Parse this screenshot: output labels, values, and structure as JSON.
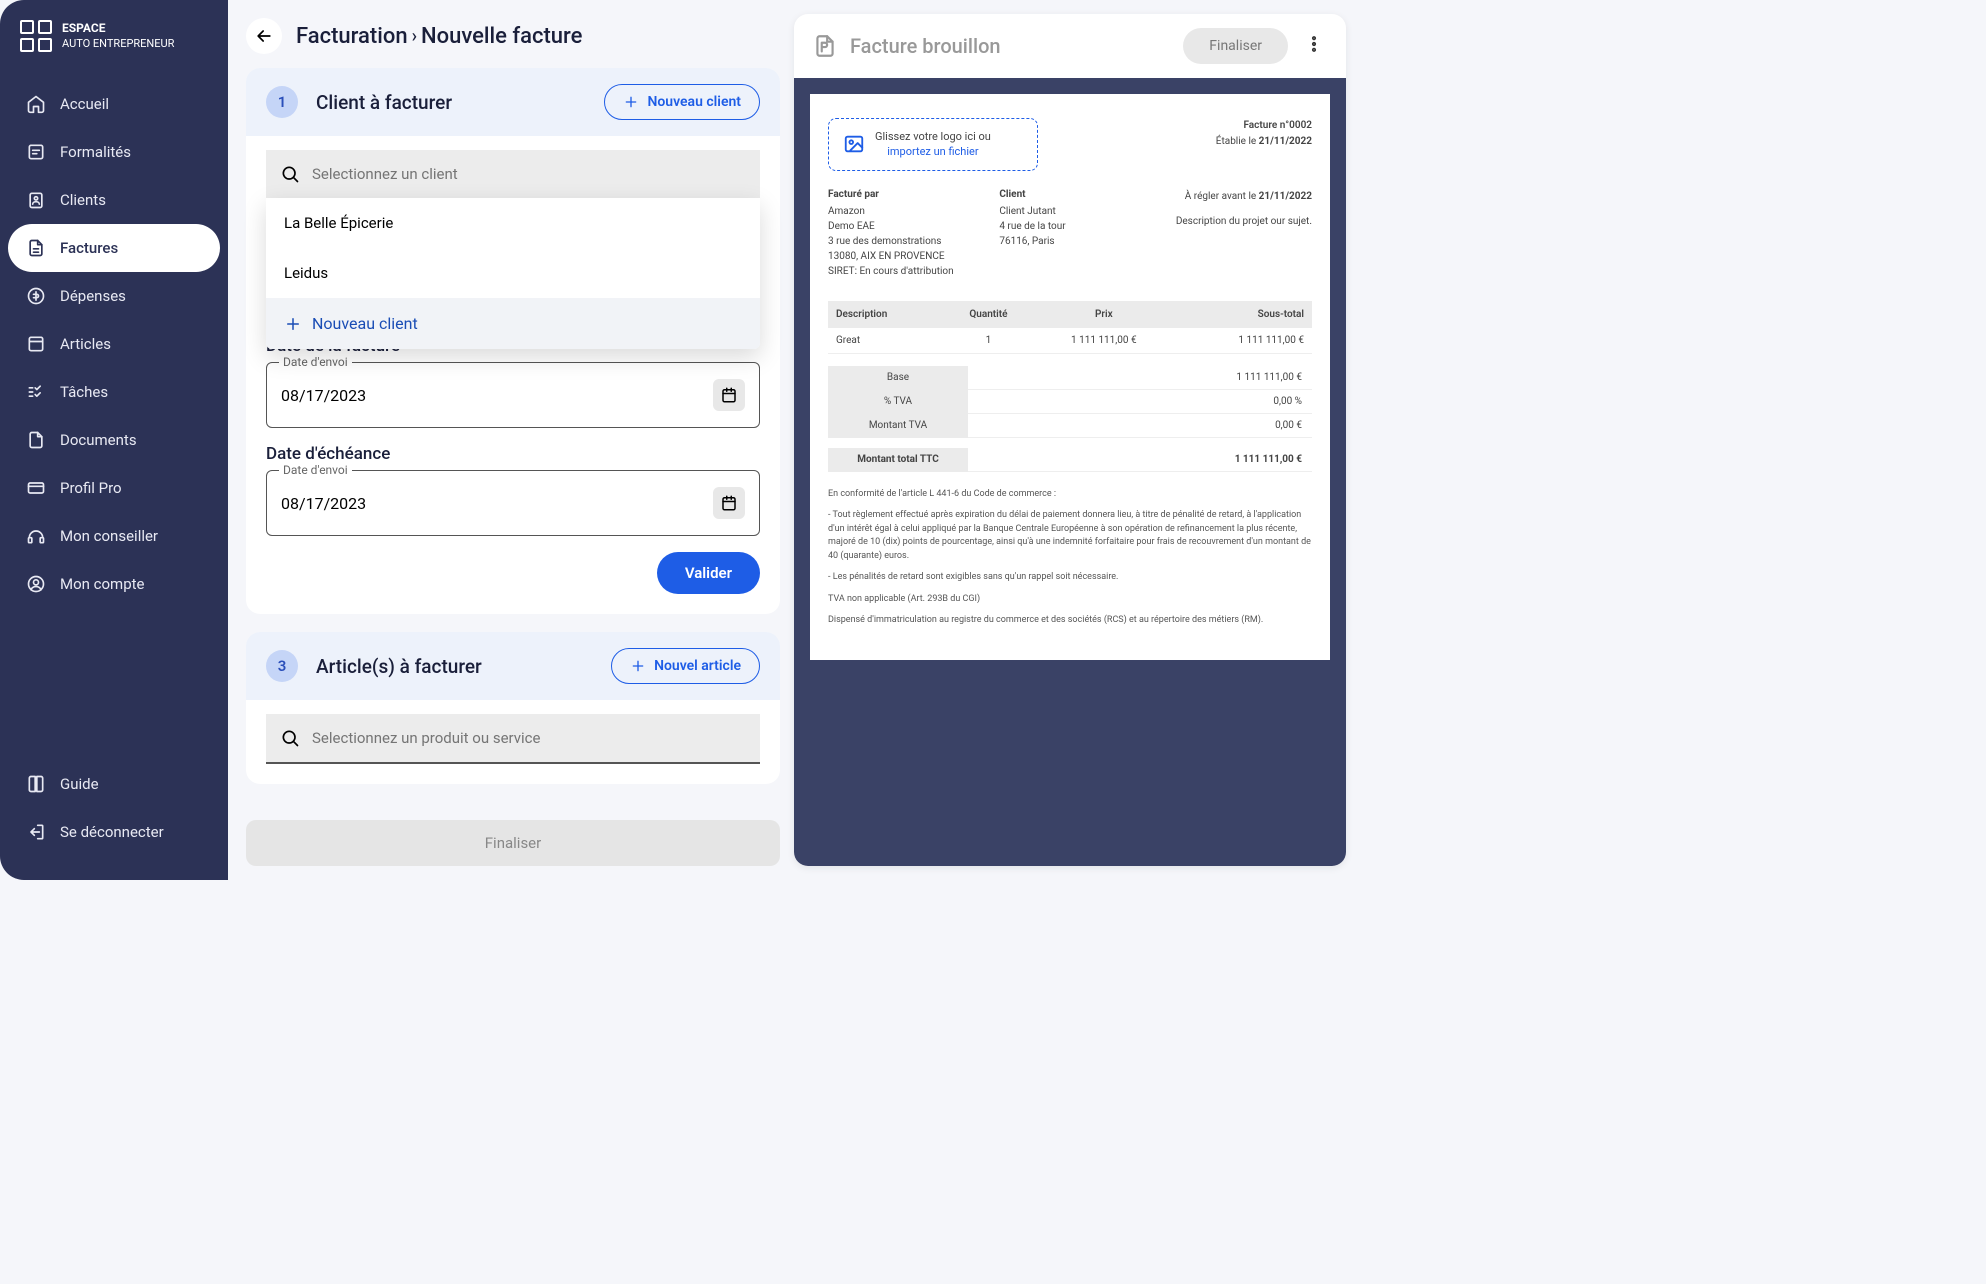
{
  "brand": {
    "line1": "ESPACE",
    "line2": "AUTO ENTREPRENEUR"
  },
  "nav": {
    "accueil": "Accueil",
    "formalites": "Formalités",
    "clients": "Clients",
    "factures": "Factures",
    "depenses": "Dépenses",
    "articles": "Articles",
    "taches": "Tâches",
    "documents": "Documents",
    "profil": "Profil Pro",
    "conseiller": "Mon conseiller",
    "compte": "Mon compte",
    "guide": "Guide",
    "deconnecter": "Se déconnecter"
  },
  "breadcrumb": {
    "a": "Facturation",
    "b": "Nouvelle facture"
  },
  "step1": {
    "num": "1",
    "title": "Client à facturer",
    "new_btn": "Nouveau client",
    "search_placeholder": "Selectionnez un client",
    "options": [
      "La Belle Épicerie",
      "Leidus"
    ],
    "dd_new": "Nouveau client",
    "date_facture_label": "Date de la facture",
    "date_echeance_label": "Date d'échéance",
    "date_floating": "Date d'envoi",
    "date_value": "08/17/2023",
    "valider": "Valider"
  },
  "step3": {
    "num": "3",
    "title": "Article(s) à facturer",
    "new_btn": "Nouvel article",
    "search_placeholder": "Selectionnez un produit ou service"
  },
  "finalize": "Finaliser",
  "preview": {
    "title": "Facture brouillon",
    "finaliser": "Finaliser",
    "logo_text1": "Glissez votre logo ici ou",
    "logo_text2": "importez un fichier",
    "meta_num": "Facture n°0002",
    "meta_etablie_lbl": "Établie le ",
    "meta_etablie": "21/11/2022",
    "facture_par": "Facturé par",
    "client_lbl": "Client",
    "regler_lbl": "À régler avant le ",
    "regler_date": "21/11/2022",
    "desc_projet": "Description du projet our sujet.",
    "from": {
      "l1": "Amazon",
      "l2": "Demo EAE",
      "l3": "3 rue des demonstrations",
      "l4": "13080, AIX EN PROVENCE",
      "l5": "SIRET: En cours d'attribution"
    },
    "to": {
      "l1": "Client Jutant",
      "l2": "4 rue de la tour",
      "l3": "76116, Paris"
    },
    "th": {
      "desc": "Description",
      "qte": "Quantité",
      "prix": "Prix",
      "st": "Sous-total"
    },
    "row": {
      "desc": "Great",
      "qte": "1",
      "prix": "1 111 111,00 €",
      "st": "1 111 111,00 €"
    },
    "totals": {
      "base_lbl": "Base",
      "base": "1 111 111,00 €",
      "tva_pct_lbl": "% TVA",
      "tva_pct": "0,00 %",
      "tva_lbl": "Montant TVA",
      "tva": "0,00 €",
      "ttc_lbl": "Montant total TTC",
      "ttc": "1 111 111,00 €"
    },
    "legal1": "En conformité de l'article L 441-6 du Code de commerce :",
    "legal2": "- Tout règlement effectué après expiration du délai de paiement donnera lieu, à titre de pénalité de retard, à l'application d'un intérêt égal à celui appliqué par la Banque Centrale Européenne à son opération de refinancement la plus récente, majoré de 10 (dix) points de pourcentage, ainsi qu'à une indemnité forfaitaire pour frais de recouvrement d'un montant de 40 (quarante) euros.",
    "legal3": "- Les pénalités de retard sont exigibles sans qu'un rappel soit nécessaire.",
    "legal4": "TVA non applicable (Art. 293B du CGI)",
    "legal5": "Dispensé d'immatriculation au registre du commerce et des sociétés (RCS) et au répertoire des métiers (RM)."
  }
}
